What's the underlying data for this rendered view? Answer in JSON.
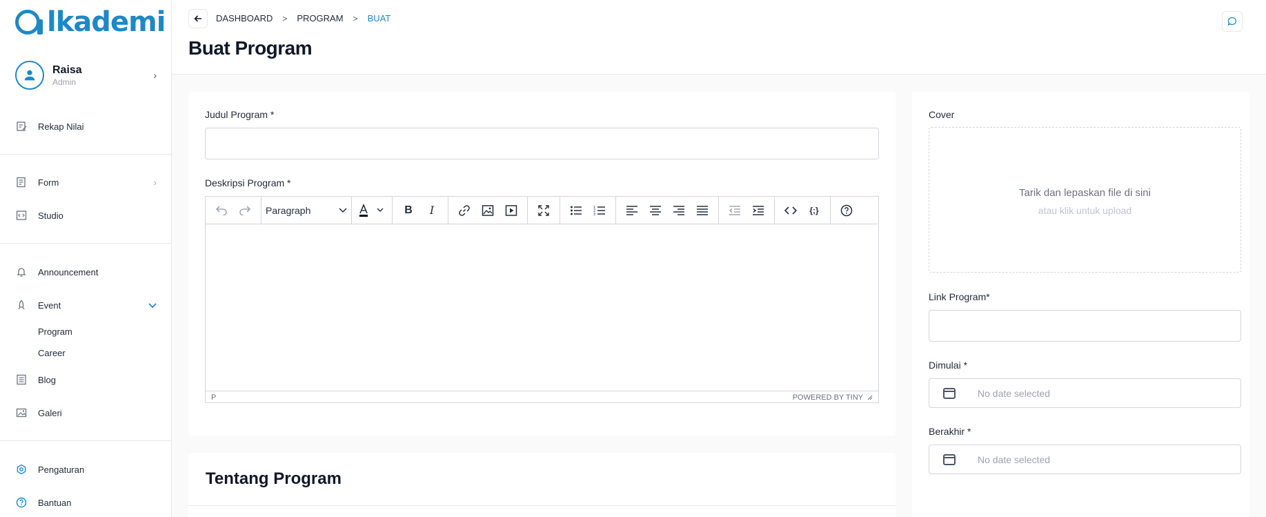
{
  "brand": {
    "logo_text": "lkademi",
    "color": "#1e88c7"
  },
  "user": {
    "name": "Raisa",
    "role": "Admin"
  },
  "sidebar": {
    "items": [
      {
        "label": "Rekap Nilai",
        "icon": "edit-note-icon"
      },
      {
        "label": "Form",
        "icon": "form-icon"
      },
      {
        "label": "Studio",
        "icon": "code-icon"
      },
      {
        "label": "Announcement",
        "icon": "bell-icon"
      },
      {
        "label": "Event",
        "icon": "rocket-icon"
      },
      {
        "label": "Blog",
        "icon": "document-icon"
      },
      {
        "label": "Galeri",
        "icon": "gallery-icon"
      },
      {
        "label": "Pengaturan",
        "icon": "gear-icon"
      },
      {
        "label": "Bantuan",
        "icon": "help-icon"
      }
    ],
    "event_subitems": [
      {
        "label": "Program"
      },
      {
        "label": "Career"
      }
    ]
  },
  "header": {
    "breadcrumb": [
      "DASHBOARD",
      "PROGRAM",
      "BUAT"
    ],
    "title": "Buat Program"
  },
  "form": {
    "judul_label": "Judul Program *",
    "judul_value": "",
    "deskripsi_label": "Deskripsi Program *",
    "editor": {
      "format_select": "Paragraph",
      "status_path": "P",
      "powered_by": "POWERED BY TINY"
    },
    "tentang_title": "Tentang Program"
  },
  "sidepanel": {
    "cover_label": "Cover",
    "dropzone_main": "Tarik dan lepaskan file di sini",
    "dropzone_sub": "atau klik untuk upload",
    "link_label": "Link Program*",
    "link_value": "",
    "start_label": "Dimulai *",
    "start_placeholder": "No date selected",
    "end_label": "Berakhir *",
    "end_placeholder": "No date selected"
  }
}
